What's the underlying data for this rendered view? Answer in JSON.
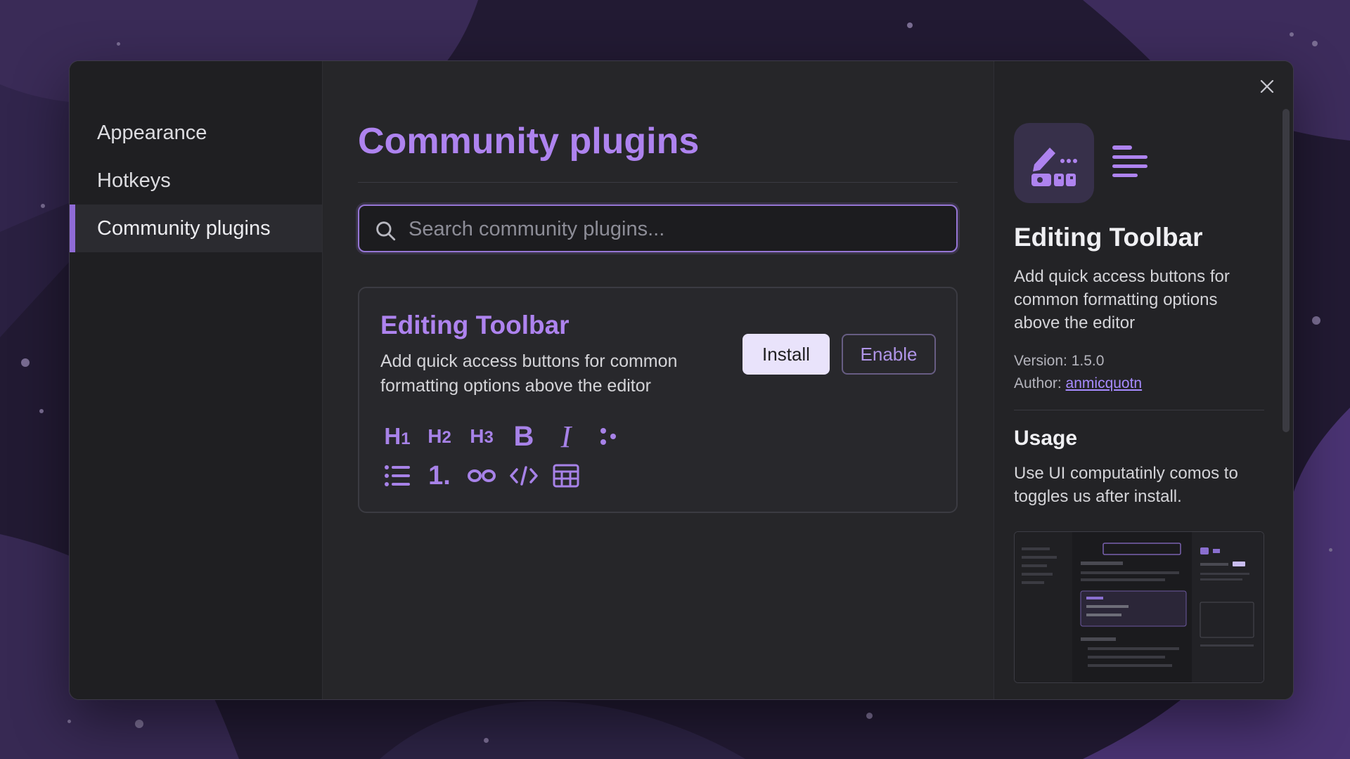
{
  "sidebar": {
    "items": [
      {
        "label": "Appearance",
        "active": false
      },
      {
        "label": "Hotkeys",
        "active": false
      },
      {
        "label": "Community plugins",
        "active": true
      }
    ]
  },
  "main": {
    "title": "Community plugins",
    "search": {
      "placeholder": "Search community plugins...",
      "value": ""
    },
    "card": {
      "title": "Editing Toolbar",
      "description": "Add quick access buttons for common formatting options above the editor",
      "install_label": "Install",
      "enable_label": "Enable",
      "toolbar_icons": [
        {
          "name": "h1",
          "label": "H",
          "sub": "1"
        },
        {
          "name": "h2",
          "label": "H",
          "sub": "2"
        },
        {
          "name": "h3",
          "label": "H",
          "sub": "3"
        },
        {
          "name": "bold",
          "label": "B"
        },
        {
          "name": "italic",
          "label": "I"
        },
        {
          "name": "dots"
        },
        {
          "name": "bullet-list"
        },
        {
          "name": "numbered-list",
          "label": "1."
        },
        {
          "name": "link"
        },
        {
          "name": "code"
        },
        {
          "name": "table"
        }
      ]
    }
  },
  "details": {
    "title": "Editing Toolbar",
    "description": "Add quick access buttons for common formatting options above the editor",
    "version_label": "Version: 1.5.0",
    "author_prefix": "Author: ",
    "author_name": "anmicquotn",
    "usage_heading": "Usage",
    "usage_text": "Use UI computatinly comos to toggles us after install.",
    "icons": [
      "pencil-icon",
      "lines-icon",
      "close-icon",
      "search-icon"
    ]
  },
  "colors": {
    "accent": "#ae83ef",
    "accent_border": "#9676d6",
    "install_bg": "#e9e3fb",
    "link": "#a78bff",
    "background": "#231b34"
  }
}
